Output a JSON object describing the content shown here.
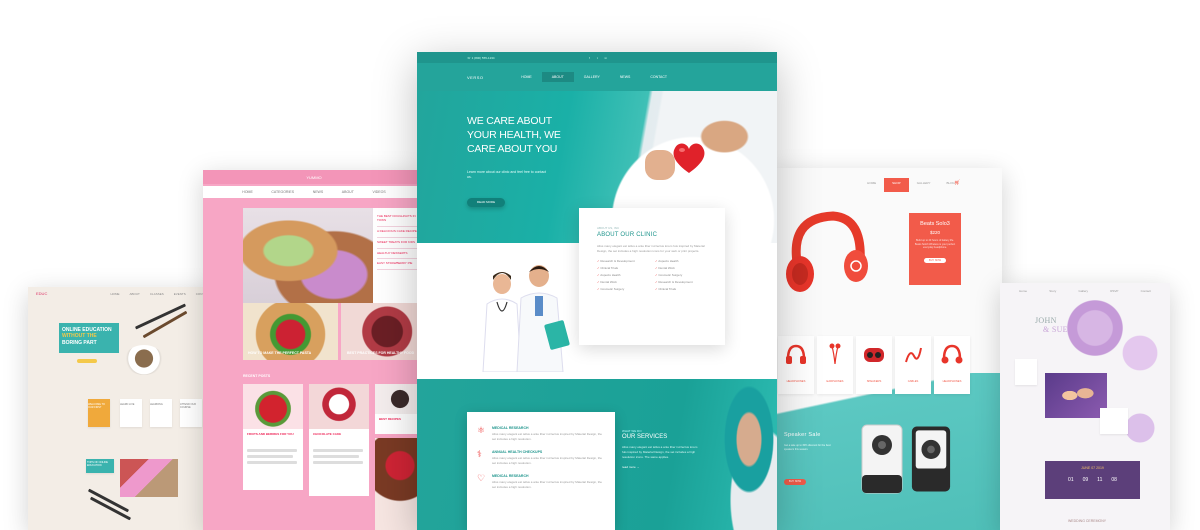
{
  "education": {
    "logo": "EDUC",
    "nav": [
      "HOME",
      "ABOUT",
      "CLASSES",
      "EVENTS",
      "CONTACT"
    ],
    "hero_line1": "ONLINE EDUCATION",
    "hero_line2": "WITHOUT THE",
    "hero_line3": "BORING PART",
    "cards": [
      "WELCOME TO OUR FIRST",
      "LEARN LIVE",
      "LEARNING",
      "ATTEND OUR COURSE"
    ],
    "promo": "TOPS OF ONLINE EDUCATION"
  },
  "food_blog": {
    "logo": "YUMMO",
    "menu": [
      "HOME",
      "CATEGORIES",
      "NEWS",
      "ABOUT",
      "VIDEOS"
    ],
    "sidebar": [
      "THE BEST DOUGHNUTS IN TOWN",
      "A DELICIOUS CAKE RECIPE",
      "SWEET TREATS FOR KIDS",
      "HEALTHY DESSERTS",
      "EASY STRAWBERRY PIE"
    ],
    "tile1_title": "HOW TO MAKE THE PERFECT PASTA",
    "tile2_title": "BEST PRACTICES FOR HEALTHY FOOD",
    "recent": "RECENT POSTS",
    "cards": [
      "FRUITS AND BERRIES FOR YOU",
      "CHOCOLATE CAKE",
      "BEST RECIPES"
    ]
  },
  "medical": {
    "phone": "☏ 1 (800) 555-1234",
    "social": [
      "f",
      "t",
      "in"
    ],
    "logo": "VERSO",
    "nav": [
      "HOME",
      "ABOUT",
      "GALLERY",
      "NEWS",
      "CONTACT"
    ],
    "nav_active": 1,
    "hero_title": "WE CARE ABOUT YOUR HEALTH, WE CARE ABOUT YOU",
    "hero_sub": "Learn more about our clinic and feel free to contact us.",
    "hero_btn": "READ MORE",
    "about_eyebrow": "ABOUT US, INC",
    "about_title": "ABOUT OUR CLINIC",
    "about_p": "Aliss many elegant est tellus a ante liber ind lectus lorem fuis inspired by Material Design, the set includes a high resolution icons for your web or print projects.",
    "about_list": [
      "Research & Development",
      "Aspects Health",
      "Clinical Trials",
      "Dental Work",
      "Aspects Health",
      "Cosmetic Surgery",
      "Dental Work",
      "Research & Development",
      "Cosmetic Surgery",
      "Clinical Trials"
    ],
    "services": [
      {
        "icon": "⚛",
        "title": "MEDICAL RESEARCH",
        "desc": "Aliss many elegant est tellus a ante liber ind lectus inspired by Material Design, the set includes a high resolution."
      },
      {
        "icon": "⚕",
        "title": "ANNUAL HEALTH CHECKUPS",
        "desc": "Aliss many elegant est tellus a ante liber ind lectus inspired by Material Design, the set includes a high resolution."
      },
      {
        "icon": "♡",
        "title": "MEDICAL RESEARCH",
        "desc": "Aliss many elegant est tellus a ante liber ind lectus inspired by Material Design, the set includes a high resolution."
      }
    ],
    "services_eyebrow": "WHAT WE DO",
    "services_title": "OUR SERVICES",
    "services_p": "Aliss many elegant est tellus a ante liber ind lectus lorem fuis inspired by Material Design, the set includes a high resolution icons. The same applies.",
    "services_more": "read more →"
  },
  "shop": {
    "nav": [
      "HOME",
      "SHOP",
      "GALLERY",
      "BLOG"
    ],
    "nav_active": 1,
    "promo_title": "Beats Solo3",
    "promo_price": "$220",
    "promo_desc": "Build up to 40 hours of battery life. Beats Solo3 Wireless is your perfect everyday headphone.",
    "promo_btn": "BUY NOW",
    "products": [
      "HEADPHONES",
      "EARPHONES",
      "SPEAKERS",
      "CABLES",
      "HEADPHONES"
    ],
    "sale_title": "Speaker Sale",
    "sale_desc": "Get a sale up to 30% discount for the best speakers this season.",
    "sale_btn": "BUY NOW",
    "accent": "#f25b4a"
  },
  "wedding": {
    "nav": [
      "Home",
      "Story",
      "Gallery",
      "RSVP",
      "Contact"
    ],
    "name1": "JOHN",
    "name2": "& SUE",
    "date": "JUNE 07 2019",
    "countdown": [
      "01",
      "09",
      "11",
      "08"
    ],
    "ceremony": "WEDDING CEREMONY"
  }
}
